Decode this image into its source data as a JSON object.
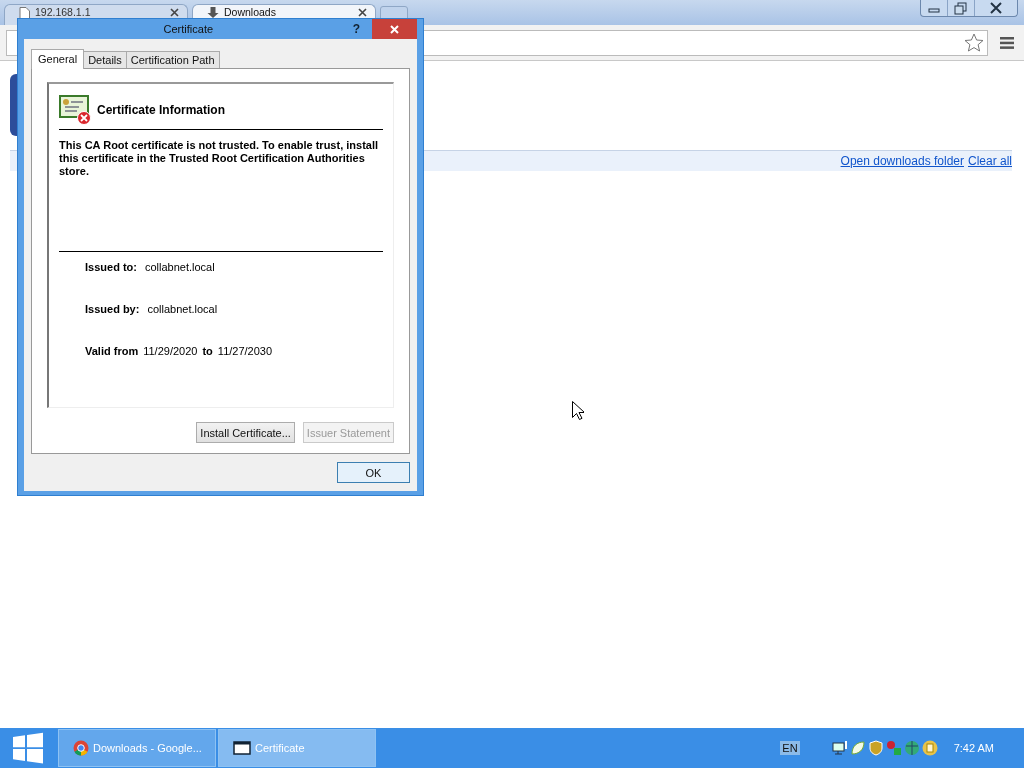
{
  "browser": {
    "tabs": [
      {
        "label": "192.168.1.1",
        "selected": false
      },
      {
        "label": "Downloads",
        "selected": true
      }
    ],
    "downloads_bar": {
      "links": [
        "Open downloads folder",
        "Clear all"
      ]
    }
  },
  "dialog": {
    "title": "Certificate",
    "help": "?",
    "tabs": [
      {
        "label": "General",
        "selected": true
      },
      {
        "label": "Details",
        "selected": false
      },
      {
        "label": "Certification Path",
        "selected": false
      }
    ],
    "heading": "Certificate Information",
    "message": "This CA Root certificate is not trusted. To enable trust, install this certificate in the Trusted Root Certification Authorities store.",
    "fields": [
      {
        "label": "Issued to:",
        "value": "collabnet.local"
      },
      {
        "label": "Issued by:",
        "value": "collabnet.local"
      }
    ],
    "validity": {
      "label": "Valid from",
      "from": "11/29/2020",
      "to_label": "to",
      "to": "11/27/2030"
    },
    "buttons": [
      {
        "label": "Install Certificate...",
        "disabled": false
      },
      {
        "label": "Issuer Statement",
        "disabled": true
      }
    ],
    "ok": "OK"
  },
  "taskbar": {
    "items": [
      {
        "label": "Downloads - Google...",
        "kind": "browser",
        "selected": false
      },
      {
        "label": "Certificate",
        "kind": "window",
        "selected": true
      }
    ],
    "language": "EN",
    "clock": "7:42 AM"
  }
}
